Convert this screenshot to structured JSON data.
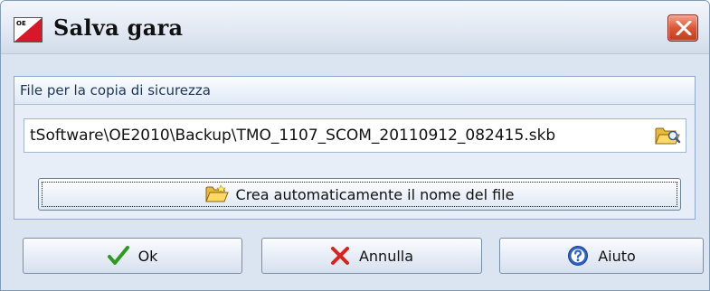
{
  "window": {
    "title": "Salva gara",
    "app_icon": "oe-logo-icon",
    "close_icon": "close-icon"
  },
  "panel": {
    "title": "File per la copia di sicurezza",
    "path_value": "tSoftware\\OE2010\\Backup\\TMO_1107_SCOM_20110912_082415.skb",
    "browse_icon": "folder-open-icon",
    "auto_name_label": "Crea automaticamente il nome del file",
    "auto_name_icon": "folder-icon"
  },
  "buttons": {
    "ok_label": "Ok",
    "cancel_label": "Annulla",
    "help_label": "Aiuto"
  },
  "colors": {
    "close_red": "#d9472b",
    "ok_green": "#2e9a1f",
    "cancel_red": "#d9231b",
    "help_blue": "#2f62c9",
    "panel_border": "#8fa8c8"
  }
}
